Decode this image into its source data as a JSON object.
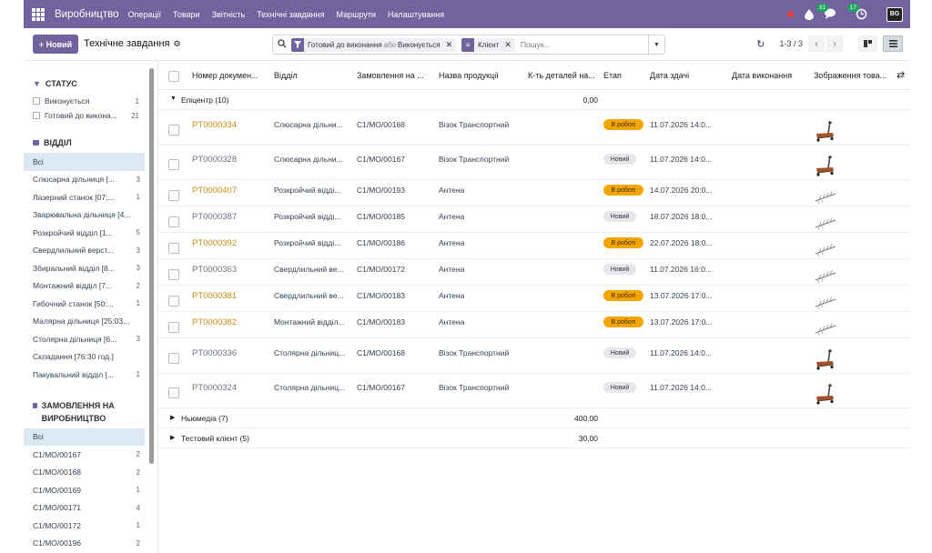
{
  "navbar": {
    "brand": "Виробництво",
    "menu": [
      "Операції",
      "Товари",
      "Звітність",
      "Технічні завдання",
      "Маршрути",
      "Налаштування"
    ],
    "activity_count": "31",
    "messages_count": "17",
    "avatar_text": "BG"
  },
  "control": {
    "new_label": "+ Новий",
    "title": "Технічне завдання",
    "facet_status_a": "Готовий до виконання",
    "facet_status_or": "або",
    "facet_status_b": "Виконується",
    "facet_client": "Клієнт",
    "search_placeholder": "Пошук...",
    "pager": "1-3 / 3"
  },
  "sidebar": {
    "status_title": "СТАТУС",
    "status_items": [
      {
        "label": "Виконується",
        "count": "1"
      },
      {
        "label": "Готовий до викона...",
        "count": "21"
      }
    ],
    "dept_title": "ВІДДІЛ",
    "dept_items": [
      {
        "label": "Всі",
        "count": ""
      },
      {
        "label": "Слюсарна дільниця [...",
        "count": "3"
      },
      {
        "label": "Лазерний станок [07:...",
        "count": "1"
      },
      {
        "label": "Зварювальна дільниця [4...",
        "count": ""
      },
      {
        "label": "Розкройчий відділ [1...",
        "count": "5"
      },
      {
        "label": "Свердлильний верст...",
        "count": "3"
      },
      {
        "label": "Збиральний відділ [8...",
        "count": "3"
      },
      {
        "label": "Монтажний відділ [7...",
        "count": "2"
      },
      {
        "label": "Гибочний станок [50:...",
        "count": "1"
      },
      {
        "label": "Малярна дільниця [25:03...",
        "count": ""
      },
      {
        "label": "Столярна дільниця [6...",
        "count": "3"
      },
      {
        "label": "Складання [76:30 год.]",
        "count": ""
      },
      {
        "label": "Пакувальний відділ [...",
        "count": "1"
      }
    ],
    "orders_title": "ЗАМОВЛЕННЯ НА ВИРОБНИЦТВО",
    "order_items": [
      {
        "label": "Всі",
        "count": ""
      },
      {
        "label": "C1/MO/00167",
        "count": "2"
      },
      {
        "label": "C1/MO/00168",
        "count": "2"
      },
      {
        "label": "C1/MO/00169",
        "count": "1"
      },
      {
        "label": "C1/MO/00171",
        "count": "4"
      },
      {
        "label": "C1/MO/00172",
        "count": "1"
      },
      {
        "label": "C1/MO/00196",
        "count": "2"
      }
    ]
  },
  "table": {
    "headers": [
      "Номер докумен...",
      "Відділ",
      "Замовлення на ...",
      "Назва продукції",
      "К-ть деталей на...",
      "Етап",
      "Дата здачі",
      "Дата виконання",
      "Зображення това..."
    ],
    "groups": [
      {
        "label": "Епіцентр (10)",
        "total": "0,00"
      },
      {
        "label": "Ньюмедіа (7)",
        "total": "400,00"
      },
      {
        "label": "Тестовий клієнт (5)",
        "total": "30,00"
      }
    ],
    "rows": [
      {
        "num": "PT0000334",
        "dept": "Слюсарна дільни...",
        "order": "C1/MO/00168",
        "product": "Візок Транспортний",
        "stage": "В роботі",
        "date": "11.07.2026 14:0...",
        "img": "cart"
      },
      {
        "num": "PT0000328",
        "dept": "Слюсарна дільни...",
        "order": "C1/MO/00167",
        "product": "Візок Транспортний",
        "stage": "Новий",
        "date": "11.07.2026 14:0...",
        "img": "cart"
      },
      {
        "num": "PT0000407",
        "dept": "Розкройчий відді...",
        "order": "C1/MO/00193",
        "product": "Антена",
        "stage": "В роботі",
        "date": "14.07.2026 20:0...",
        "img": "antenna"
      },
      {
        "num": "PT0000387",
        "dept": "Розкройчий відді...",
        "order": "C1/MO/00185",
        "product": "Антена",
        "stage": "Новий",
        "date": "18.07.2026 18:0...",
        "img": "antenna"
      },
      {
        "num": "PT0000392",
        "dept": "Розкройчий відді...",
        "order": "C1/MO/00186",
        "product": "Антена",
        "stage": "В роботі",
        "date": "22.07.2026 18:0...",
        "img": "antenna"
      },
      {
        "num": "PT0000363",
        "dept": "Свердлильний ве...",
        "order": "C1/MO/00172",
        "product": "Антена",
        "stage": "Новий",
        "date": "11.07.2026 16:0...",
        "img": "antenna"
      },
      {
        "num": "PT0000381",
        "dept": "Свердлильний ве...",
        "order": "C1/MO/00183",
        "product": "Антена",
        "stage": "В роботі",
        "date": "13.07.2026 17:0...",
        "img": "antenna"
      },
      {
        "num": "PT0000382",
        "dept": "Монтажний відділ...",
        "order": "C1/MO/00183",
        "product": "Антена",
        "stage": "В роботі",
        "date": "13.07.2026 17:0...",
        "img": "antenna"
      },
      {
        "num": "PT0000336",
        "dept": "Столярна дільниц...",
        "order": "C1/MO/00168",
        "product": "Візок Транспортний",
        "stage": "Новий",
        "date": "11.07.2026 14:0...",
        "img": "cart"
      },
      {
        "num": "PT0000324",
        "dept": "Столярна дільниц...",
        "order": "C1/MO/00167",
        "product": "Візок Транспортний",
        "stage": "Новий",
        "date": "11.07.2026 14:0...",
        "img": "cart"
      }
    ]
  },
  "colors": {
    "accent": "#71639e",
    "in_work": "#f5a500",
    "orange_text": "#c88b14"
  }
}
